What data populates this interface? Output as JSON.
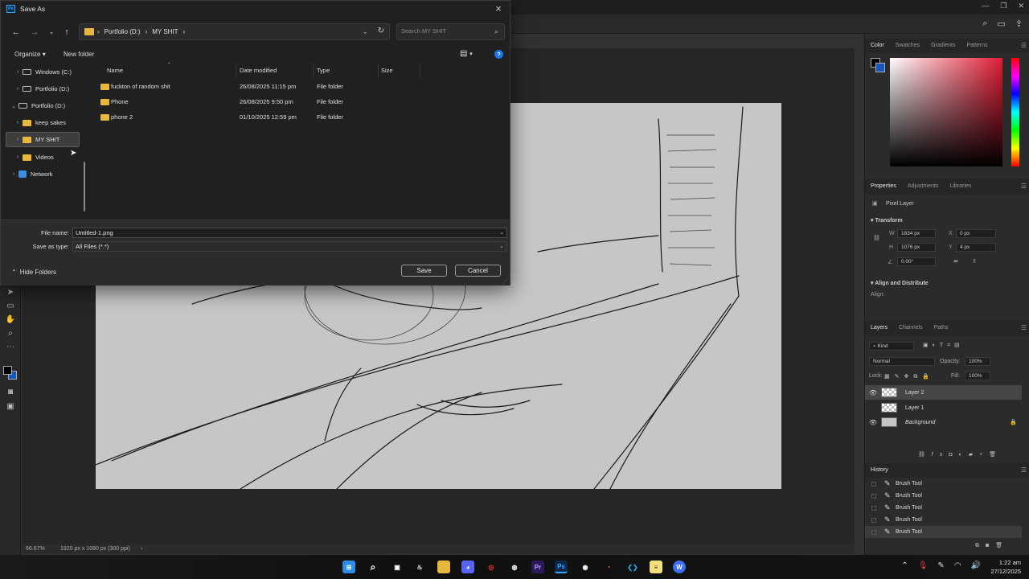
{
  "dialog": {
    "title": "Save As",
    "app_icon": "Ps",
    "address_path": [
      "Portfolio (D:)",
      "MY SHIT"
    ],
    "search_placeholder": "Search MY SHIT",
    "commands": {
      "organize": "Organize",
      "new_folder": "New folder"
    },
    "nav_items": [
      {
        "label": "Windows (C:)",
        "icon": "drive-icon",
        "expanded": false
      },
      {
        "label": "Portfolio (D:)",
        "icon": "drive-icon",
        "expanded": false
      },
      {
        "label": "Portfolio (D:)",
        "icon": "drive-icon",
        "expanded": true
      },
      {
        "label": "keep sakes",
        "icon": "folder-icon",
        "expanded": false
      },
      {
        "label": "MY SHIT",
        "icon": "folder-icon",
        "expanded": false,
        "selected": true
      },
      {
        "label": "Videos",
        "icon": "folder-icon",
        "expanded": false
      },
      {
        "label": "Network",
        "icon": "network-icon",
        "expanded": false
      }
    ],
    "columns": [
      "Name",
      "Date modified",
      "Type",
      "Size"
    ],
    "files": [
      {
        "name": "fuckton of random shit",
        "date": "26/08/2025 11:15 pm",
        "type": "File folder",
        "size": ""
      },
      {
        "name": "Phone",
        "date": "26/08/2025 9:50 pm",
        "type": "File folder",
        "size": ""
      },
      {
        "name": "phone 2",
        "date": "01/10/2025 12:59 pm",
        "type": "File folder",
        "size": ""
      }
    ],
    "file_name_label": "File name:",
    "file_name_value": "Untitled-1.png",
    "save_type_label": "Save as type:",
    "save_type_value": "All Files (*.*)",
    "hide_folders": "Hide Folders",
    "save_button": "Save",
    "cancel_button": "Cancel"
  },
  "photoshop": {
    "color_tabs": [
      "Color",
      "Swatches",
      "Gradients",
      "Patterns"
    ],
    "properties_tabs": [
      "Properties",
      "Adjustments",
      "Libraries"
    ],
    "pixel_layer": "Pixel Layer",
    "transform_title": "Transform",
    "transform": {
      "w_label": "W",
      "w": "1834 px",
      "x_label": "X",
      "x": "0 px",
      "h_label": "H",
      "h": "1076 px",
      "y_label": "Y",
      "y": "4 px",
      "angle": "0.00°"
    },
    "align_title": "Align and Distribute",
    "align_label": "Align:",
    "layers_tabs": [
      "Layers",
      "Channels",
      "Paths"
    ],
    "kind": "Kind",
    "blend_mode": "Normal",
    "opacity_label": "Opacity:",
    "opacity": "100%",
    "lock_label": "Lock:",
    "fill_label": "Fill:",
    "fill": "100%",
    "layers": [
      {
        "name": "Layer 2",
        "visible": true,
        "selected": true
      },
      {
        "name": "Layer 1",
        "visible": false,
        "selected": false
      },
      {
        "name": "Background",
        "visible": true,
        "selected": false
      }
    ],
    "history_title": "History",
    "history": [
      "Brush Tool",
      "Brush Tool",
      "Brush Tool",
      "Brush Tool",
      "Brush Tool"
    ],
    "zoom": "66.67%",
    "doc_info": "1920 px x 1080 px (300 ppi)"
  },
  "taskbar": {
    "time": "1:22 am",
    "date": "27/12/2025"
  },
  "colors": {
    "accent_blue": "#1a73e8",
    "folder_yellow": "#e8b83e",
    "ps_blue": "#31a8ff",
    "background_color": "#1557c0"
  }
}
